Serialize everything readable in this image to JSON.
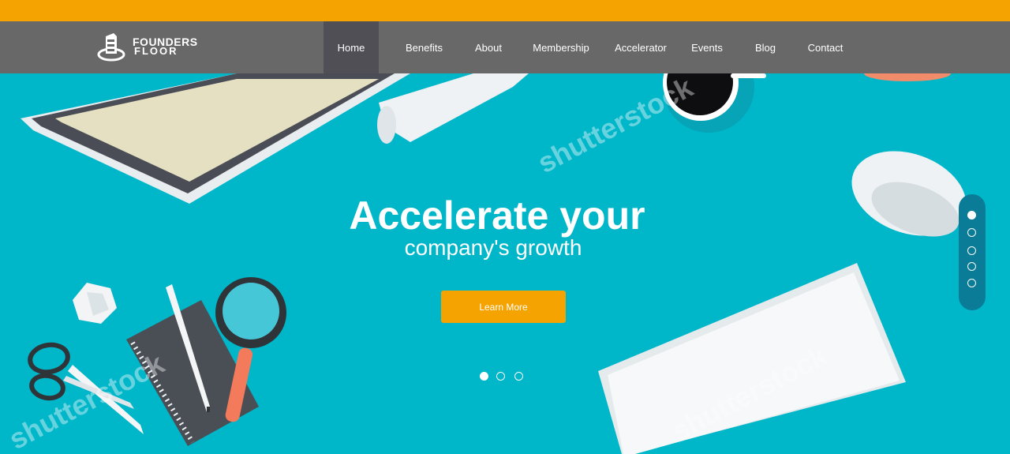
{
  "brand": {
    "name_line1": "FOUNDERS",
    "name_line2": "FLOOR",
    "accent_color": "#f4a300",
    "nav_bg": "#686868",
    "hero_bg": "#00b6c9"
  },
  "nav": {
    "items": [
      {
        "label": "Home",
        "active": true
      },
      {
        "label": "Benefits"
      },
      {
        "label": "About"
      },
      {
        "label": "Membership"
      },
      {
        "label": "Accelerator"
      },
      {
        "label": "Events"
      },
      {
        "label": "Blog"
      },
      {
        "label": "Contact"
      }
    ]
  },
  "hero": {
    "headline": "Accelerate your",
    "subheadline": "company's growth",
    "cta_label": "Learn More",
    "watermark": "shutterstock",
    "slider_count": 3,
    "slider_active_index": 0,
    "side_nav_count": 5,
    "side_nav_active_index": 0
  }
}
